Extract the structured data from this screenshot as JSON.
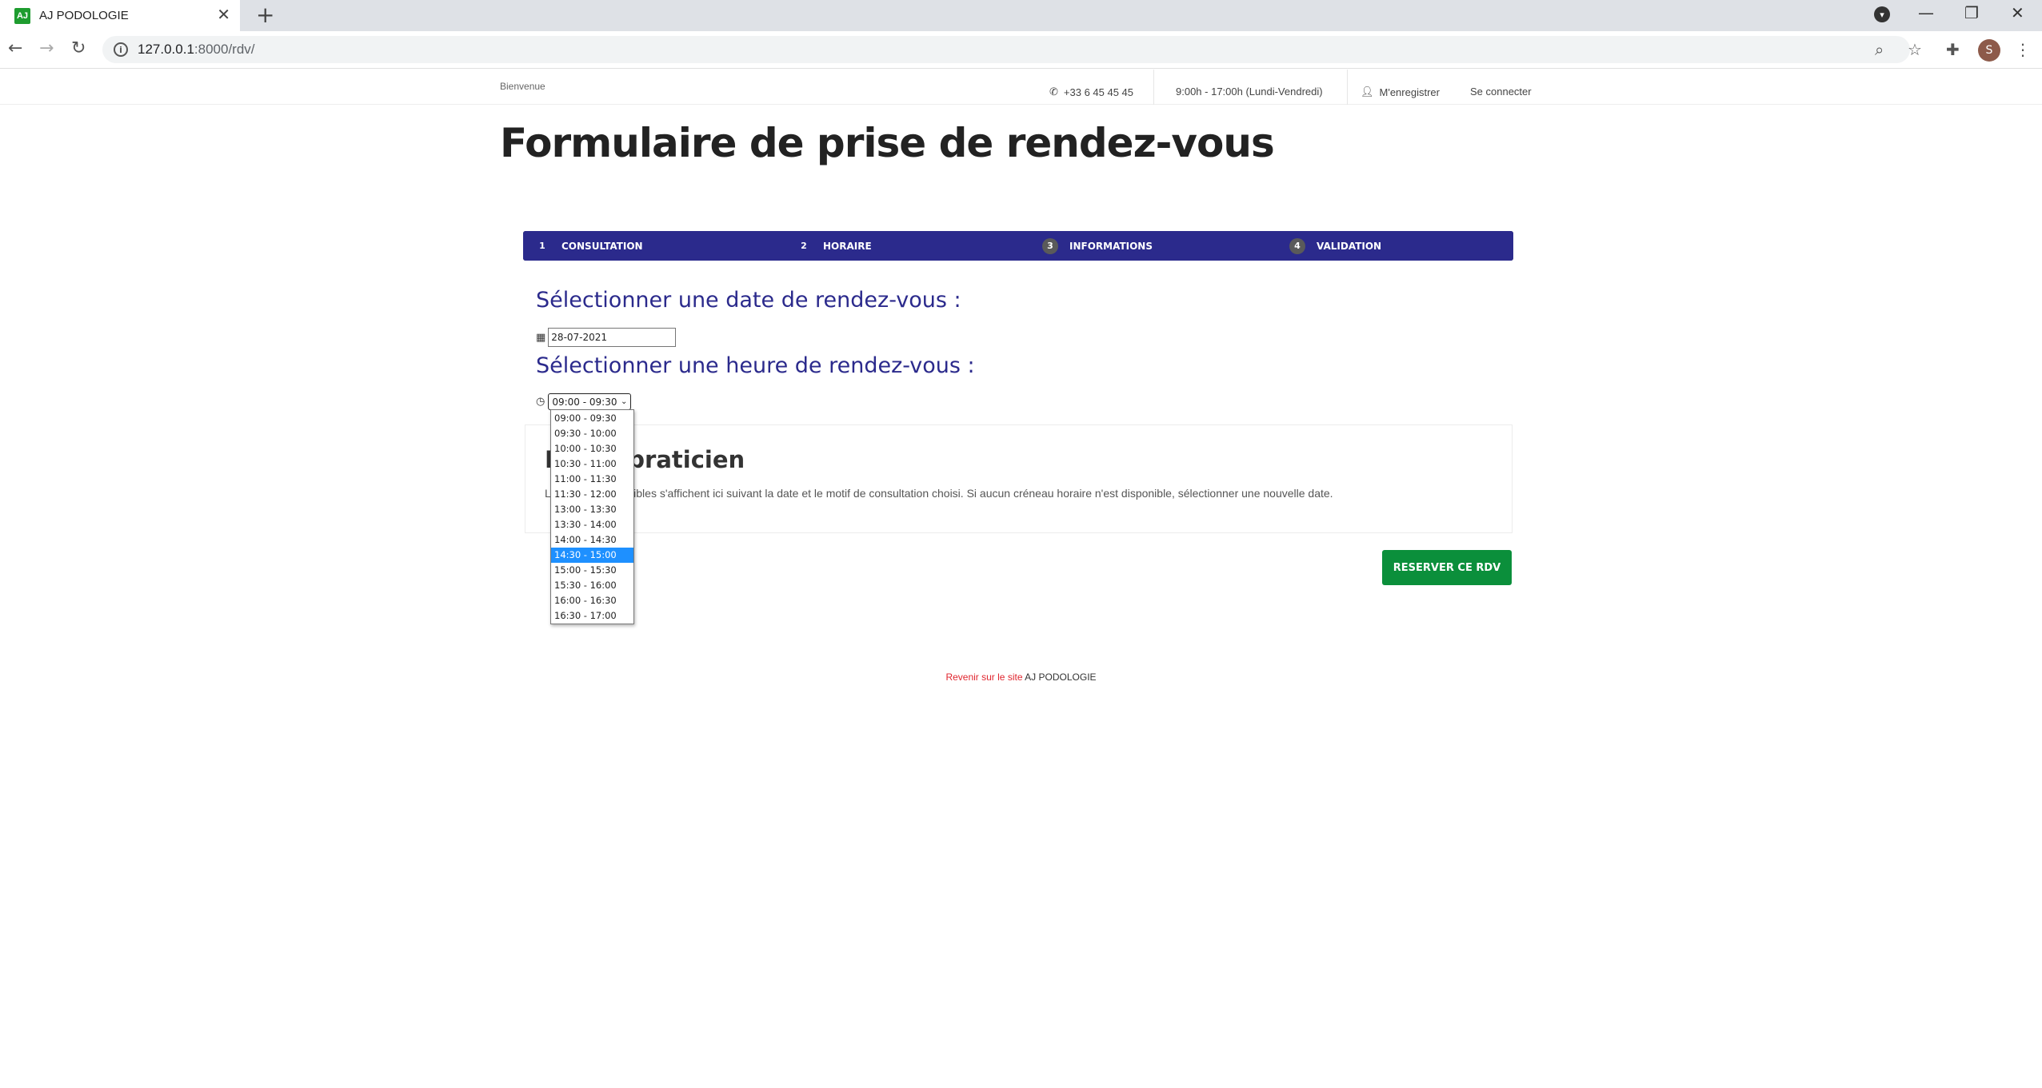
{
  "browser": {
    "tab_title": "AJ PODOLOGIE",
    "favicon_text": "AJ",
    "url_host": "127.0.0.1",
    "url_rest": ":8000/rdv/",
    "profile_initial": "S"
  },
  "header": {
    "welcome": "Bienvenue",
    "phone": "+33 6 45 45 45",
    "hours": "9:00h - 17:00h (Lundi-Vendredi)",
    "register": "M'enregistrer",
    "login": "Se connecter"
  },
  "page_title": "Formulaire de prise de rendez-vous",
  "steps": [
    {
      "num": "1",
      "label": "CONSULTATION",
      "active": true
    },
    {
      "num": "2",
      "label": "HORAIRE",
      "active": true
    },
    {
      "num": "3",
      "label": "INFORMATIONS",
      "active": false
    },
    {
      "num": "4",
      "label": "VALIDATION",
      "active": false
    }
  ],
  "date_section": {
    "heading": "Sélectionner une date de rendez-vous :",
    "value": "28-07-2021"
  },
  "time_section": {
    "heading": "Sélectionner une heure de rendez-vous :",
    "selected_value": "09:00 - 09:30",
    "options": [
      "09:00 - 09:30",
      "09:30 - 10:00",
      "10:00 - 10:30",
      "10:30 - 11:00",
      "11:00 - 11:30",
      "11:30 - 12:00",
      "13:00 - 13:30",
      "13:30 - 14:00",
      "14:00 - 14:30",
      "14:30 - 15:00",
      "15:00 - 15:30",
      "15:30 - 16:00",
      "16:00 - 16:30",
      "16:30 - 17:00"
    ],
    "highlighted_option": "14:30 - 15:00"
  },
  "info_box": {
    "title_visible": "praticien",
    "title_prefix_visible": "N",
    "text_prefix_visible": "L",
    "text_visible": "ponibles s'affichent ici suivant la date et le motif de consultation choisi. Si aucun créneau horaire n'est disponible, sélectionner une nouvelle date."
  },
  "reserve_button": "RESERVER CE RDV",
  "footer": {
    "link_text": "Revenir sur le site",
    "site_name": "AJ PODOLOGIE"
  },
  "colors": {
    "step_active": "#2b2a8c",
    "step_inactive": "#3e3e3e",
    "heading": "#2b2a8c",
    "reserve": "#0b8f3b",
    "footer_link": "#e0262f",
    "option_highlight": "#1e90ff"
  }
}
